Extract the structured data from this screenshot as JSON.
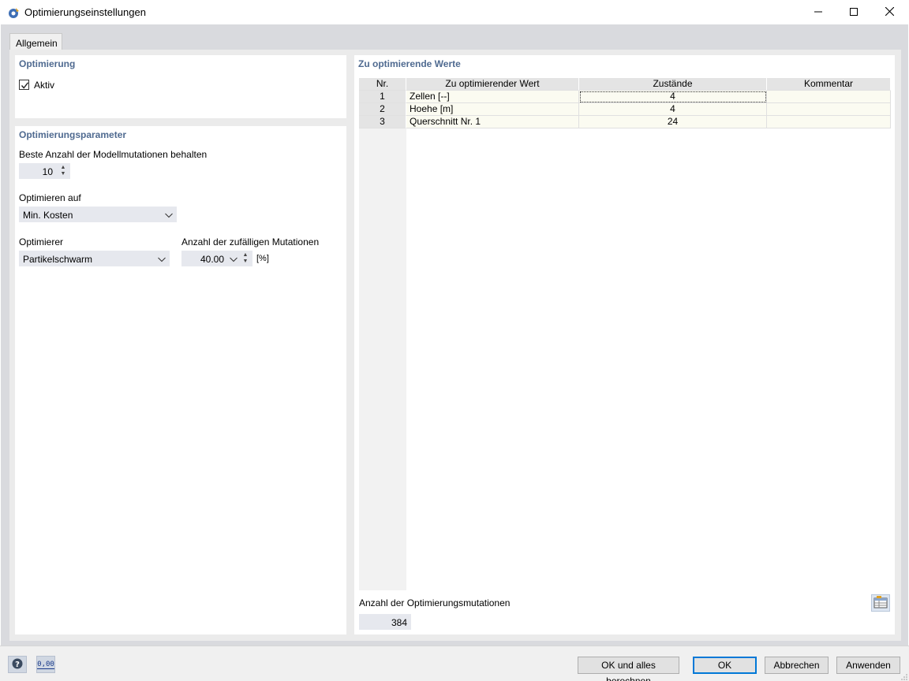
{
  "window": {
    "title": "Optimierungseinstellungen",
    "icon": "app-gear-icon",
    "controls": [
      "minimize",
      "maximize",
      "close"
    ]
  },
  "tabs": [
    {
      "label": "Allgemein",
      "active": true
    }
  ],
  "optimization": {
    "section_title": "Optimierung",
    "active_label": "Aktiv",
    "active_checked": true
  },
  "parameters": {
    "section_title": "Optimierungsparameter",
    "keep_best_label": "Beste Anzahl der Modellmutationen behalten",
    "keep_best_value": "10",
    "optimize_for_label": "Optimieren auf",
    "optimize_for_value": "Min. Kosten",
    "optimizer_label": "Optimierer",
    "optimizer_value": "Partikelschwarm",
    "random_mutations_label": "Anzahl der zufälligen Mutationen",
    "random_mutations_value": "40.00",
    "random_mutations_unit": "[%]"
  },
  "values": {
    "section_title": "Zu optimierende Werte",
    "columns": [
      "Nr.",
      "Zu optimierender Wert",
      "Zustände",
      "Kommentar"
    ],
    "rows": [
      {
        "nr": "1",
        "name": "Zellen [--]",
        "states": "4",
        "comment": ""
      },
      {
        "nr": "2",
        "name": "Hoehe [m]",
        "states": "4",
        "comment": ""
      },
      {
        "nr": "3",
        "name": "Querschnitt Nr. 1",
        "states": "24",
        "comment": ""
      }
    ],
    "mutations_label": "Anzahl der Optimierungsmutationen",
    "mutations_value": "384"
  },
  "footer": {
    "help_icon": "help-icon",
    "units_icon": "units-icon",
    "units_icon_text": "0,00",
    "buttons": {
      "ok_calc": "OK und alles berechnen",
      "ok": "OK",
      "cancel": "Abbrechen",
      "apply": "Anwenden"
    }
  },
  "colors": {
    "section_title": "#4f6a90",
    "grid_cell_bg": "#fbfbf1",
    "grid_header_bg": "#e4e4e4",
    "input_bg": "#e6e8ee",
    "default_button_border": "#0078d7"
  }
}
